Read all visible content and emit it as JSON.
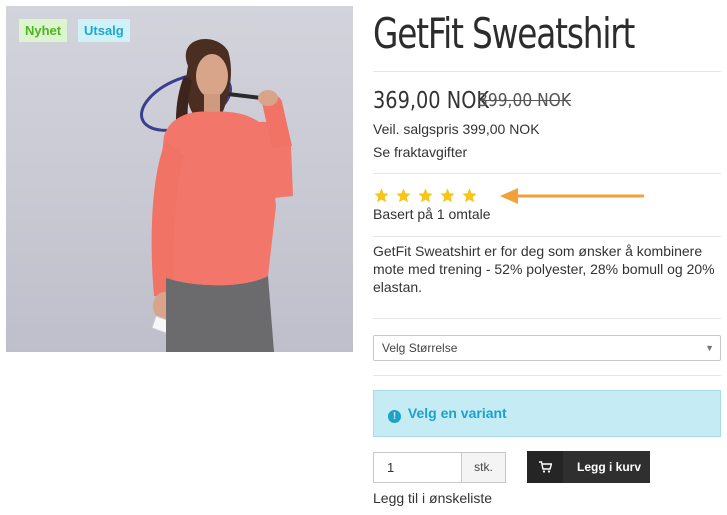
{
  "product": {
    "badges": {
      "new": "Nyhet",
      "sale": "Utsalg"
    },
    "title": "GetFit Sweatshirt",
    "price_current": "369,00 NOK",
    "price_old": "399,00 NOK",
    "recommended_price": "Veil. salgspris 399,00 NOK",
    "shipping_link": "Se fraktavgifter",
    "rating": {
      "stars": 5,
      "max": 5,
      "reviews_text": "Basert på 1 omtale"
    },
    "description": "GetFit Sweatshirt er for deg som ønsker å kombinere mote med trening - 52% polyester, 28% bomull og 20% elastan."
  },
  "variant": {
    "select_value": "Velg Størrelse"
  },
  "alert": {
    "text": "Velg en variant"
  },
  "purchase": {
    "quantity": "1",
    "unit": "stk.",
    "add_to_cart": "Legg i kurv",
    "wishlist": "Legg til i ønskeliste"
  },
  "colors": {
    "accent_arrow": "#f0a13a",
    "star": "#f5c518",
    "alert_bg": "#c5ebf5",
    "alert_text": "#1ba3c8",
    "badge_new": "#4fb51e",
    "badge_sale": "#1aa9cf"
  }
}
